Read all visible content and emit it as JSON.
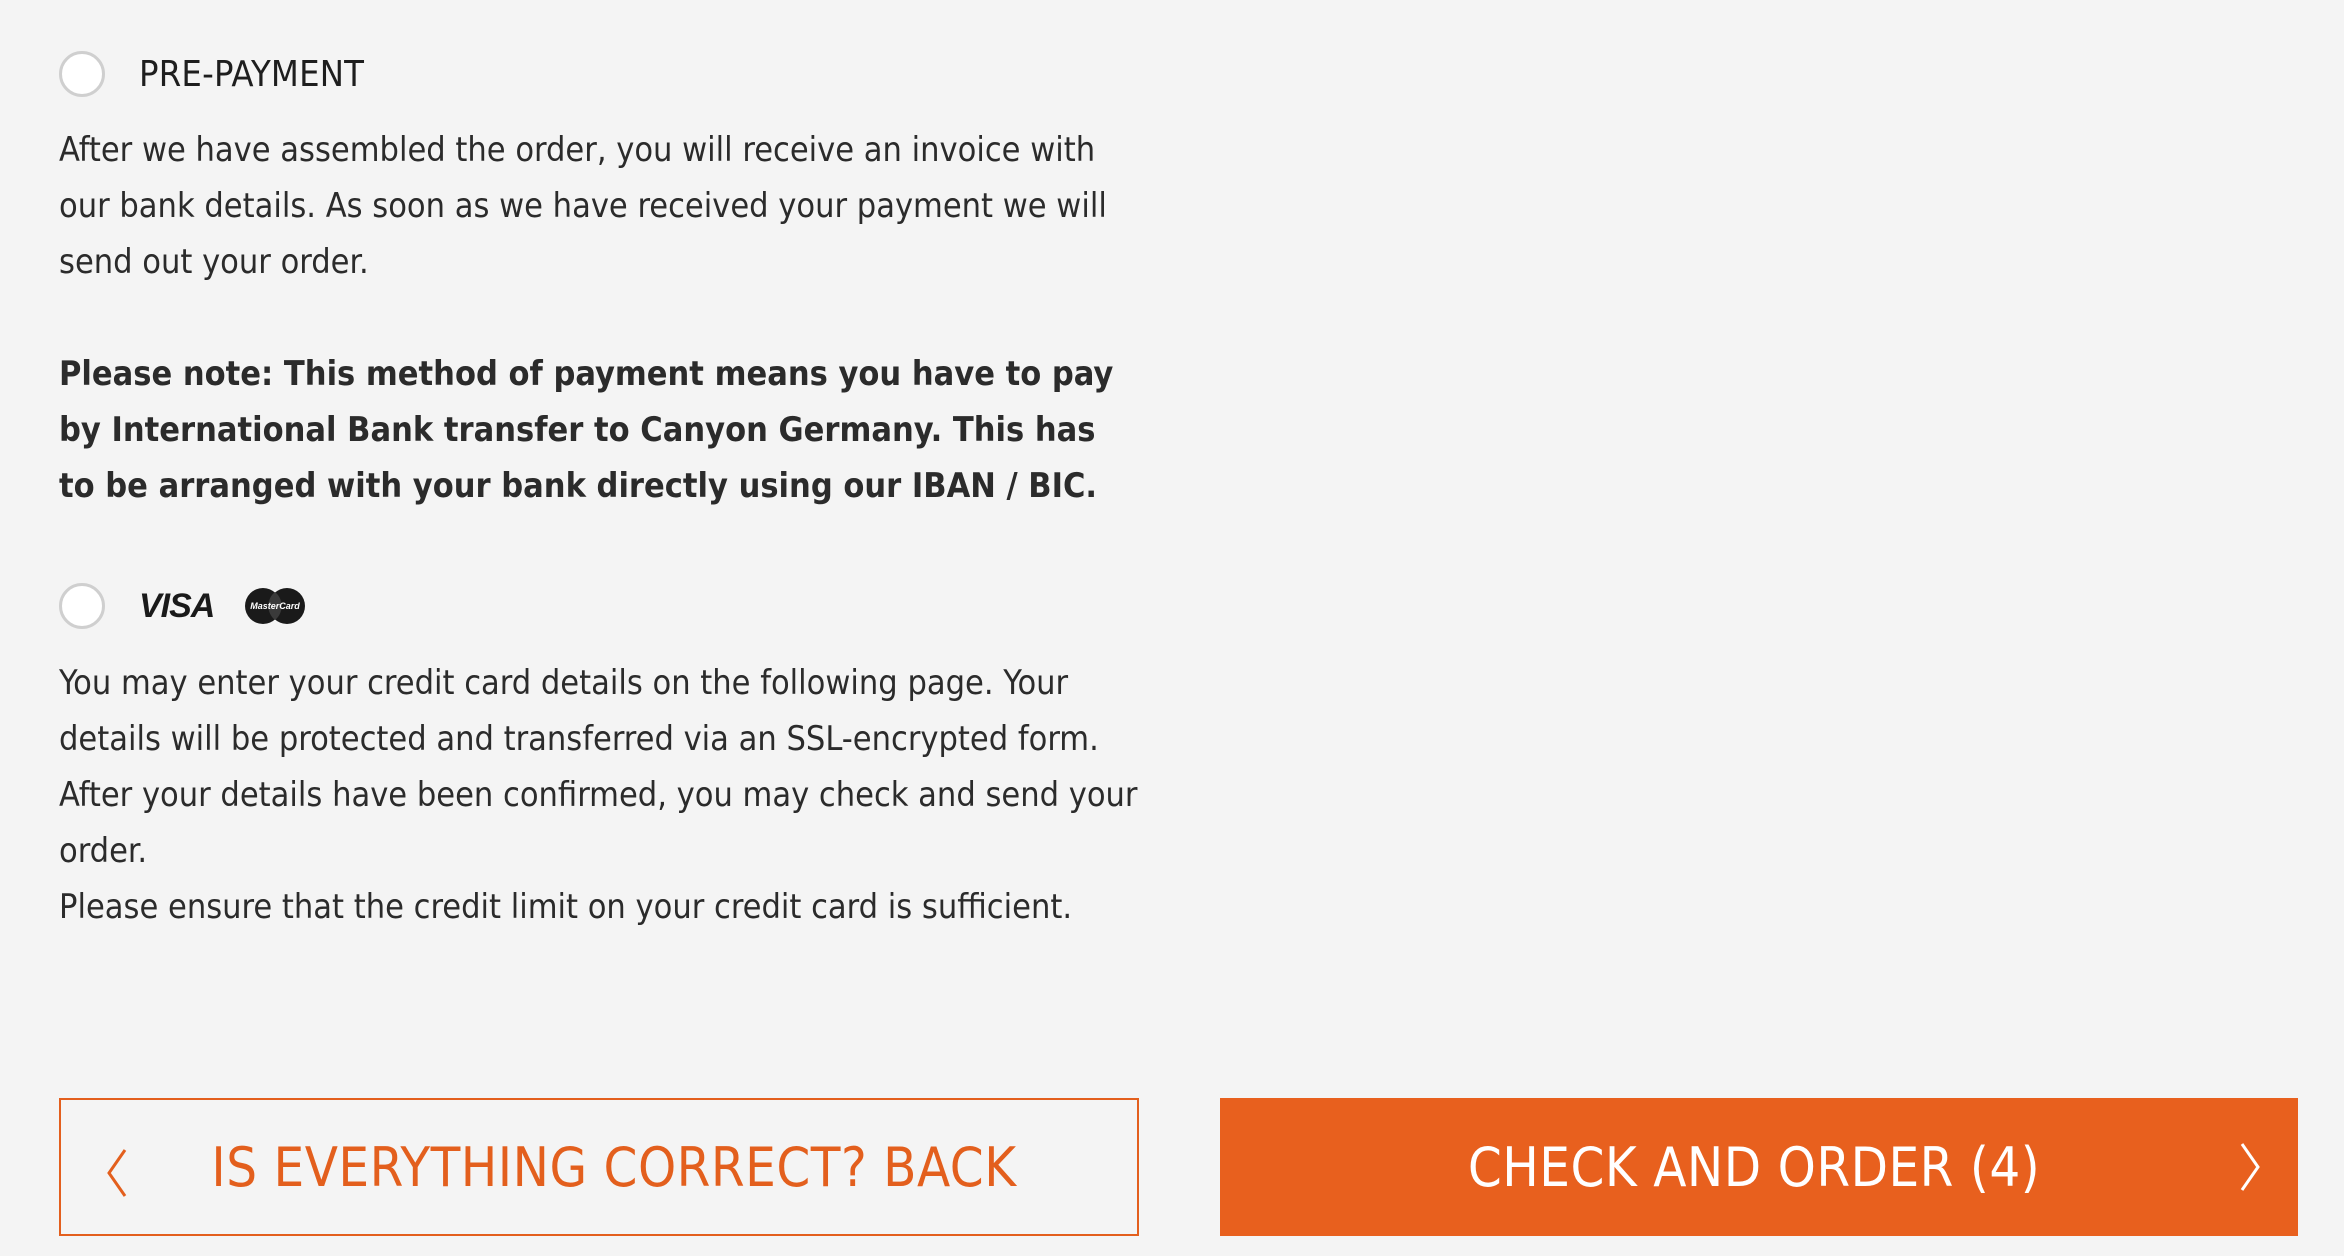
{
  "prepayment": {
    "label": "PRE-PAYMENT",
    "description": "After we have assembled the order, you will receive an invoice with our bank details. As soon as we have received your payment we will send out your order.",
    "note": "Please note: This method of payment means you have to pay by International Bank transfer to Canyon Germany. This has to be arranged with your bank directly using our IBAN / BIC."
  },
  "credit_card": {
    "visa_label": "VISA",
    "mastercard_label": "MasterCard",
    "description": "You may enter your credit card details on the following page. Your details will be protected and transferred via an SSL-encrypted form. After your details have been confirmed, you may check and send your order.",
    "limit_note": "Please ensure that the credit limit on your credit card is sufficient."
  },
  "buttons": {
    "back_label": "IS EVERYTHING CORRECT? BACK",
    "order_label": "CHECK AND ORDER (4)"
  },
  "colors": {
    "accent": "#e8601e",
    "background": "#f4f4f4",
    "text": "#2b2b2b"
  }
}
